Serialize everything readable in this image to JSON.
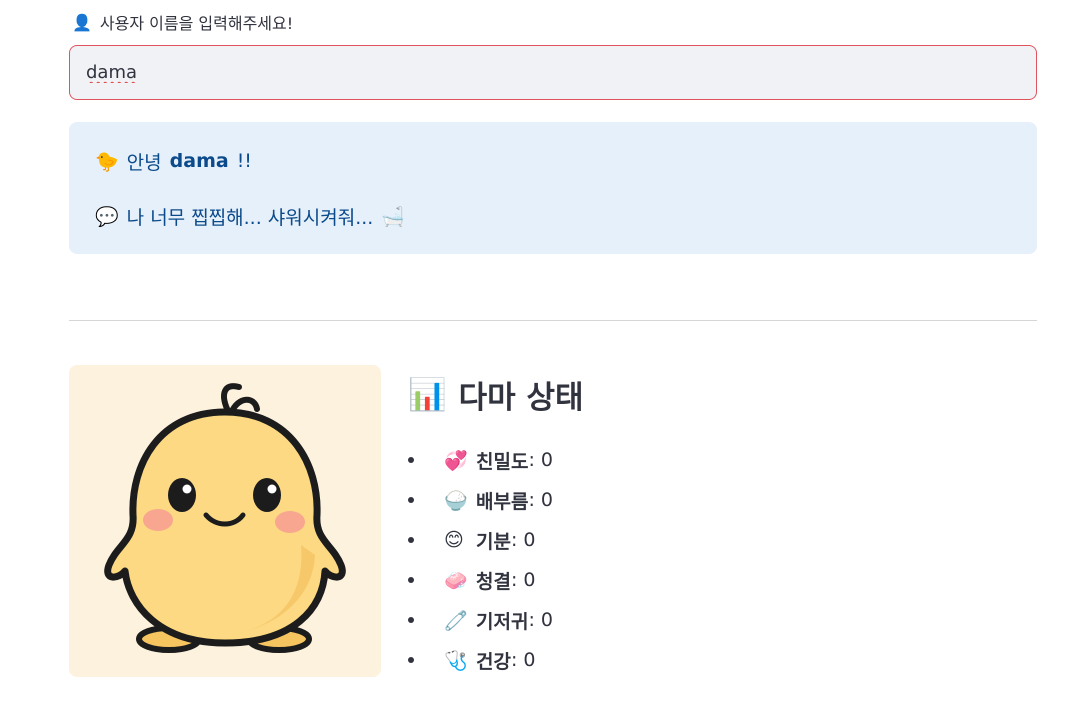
{
  "input": {
    "label_icon": "👤",
    "label": "사용자 이름을 입력해주세요!",
    "value": "dama"
  },
  "info": {
    "greeting_icon": "🐤",
    "greeting_prefix": "안녕",
    "greeting_name": "dama",
    "greeting_suffix": "!!",
    "message_icon": "💬",
    "message": "나 너무 찝찝해... 샤워시켜줘...",
    "message_end_icon": "🛁"
  },
  "status": {
    "title_icon": "📊",
    "title": "다마 상태",
    "items": [
      {
        "icon": "💞",
        "name": "친밀도",
        "value": ": 0"
      },
      {
        "icon": "🍚",
        "name": "배부름",
        "value": ": 0"
      },
      {
        "icon": "😊",
        "name": "기분",
        "value": ": 0"
      },
      {
        "icon": "🧼",
        "name": "청결",
        "value": ": 0"
      },
      {
        "icon": "🧷",
        "name": "기저귀",
        "value": ": 0"
      },
      {
        "icon": "🩺",
        "name": "건강",
        "value": ": 0"
      }
    ]
  },
  "colors": {
    "input_border": "#e0535e",
    "info_bg": "#e6f0fb",
    "info_text": "#0b4a8b",
    "avatar_bg": "#fdf2de",
    "chick_body": "#fcd982"
  },
  "avatar": {
    "icon": "chick-character-icon"
  }
}
